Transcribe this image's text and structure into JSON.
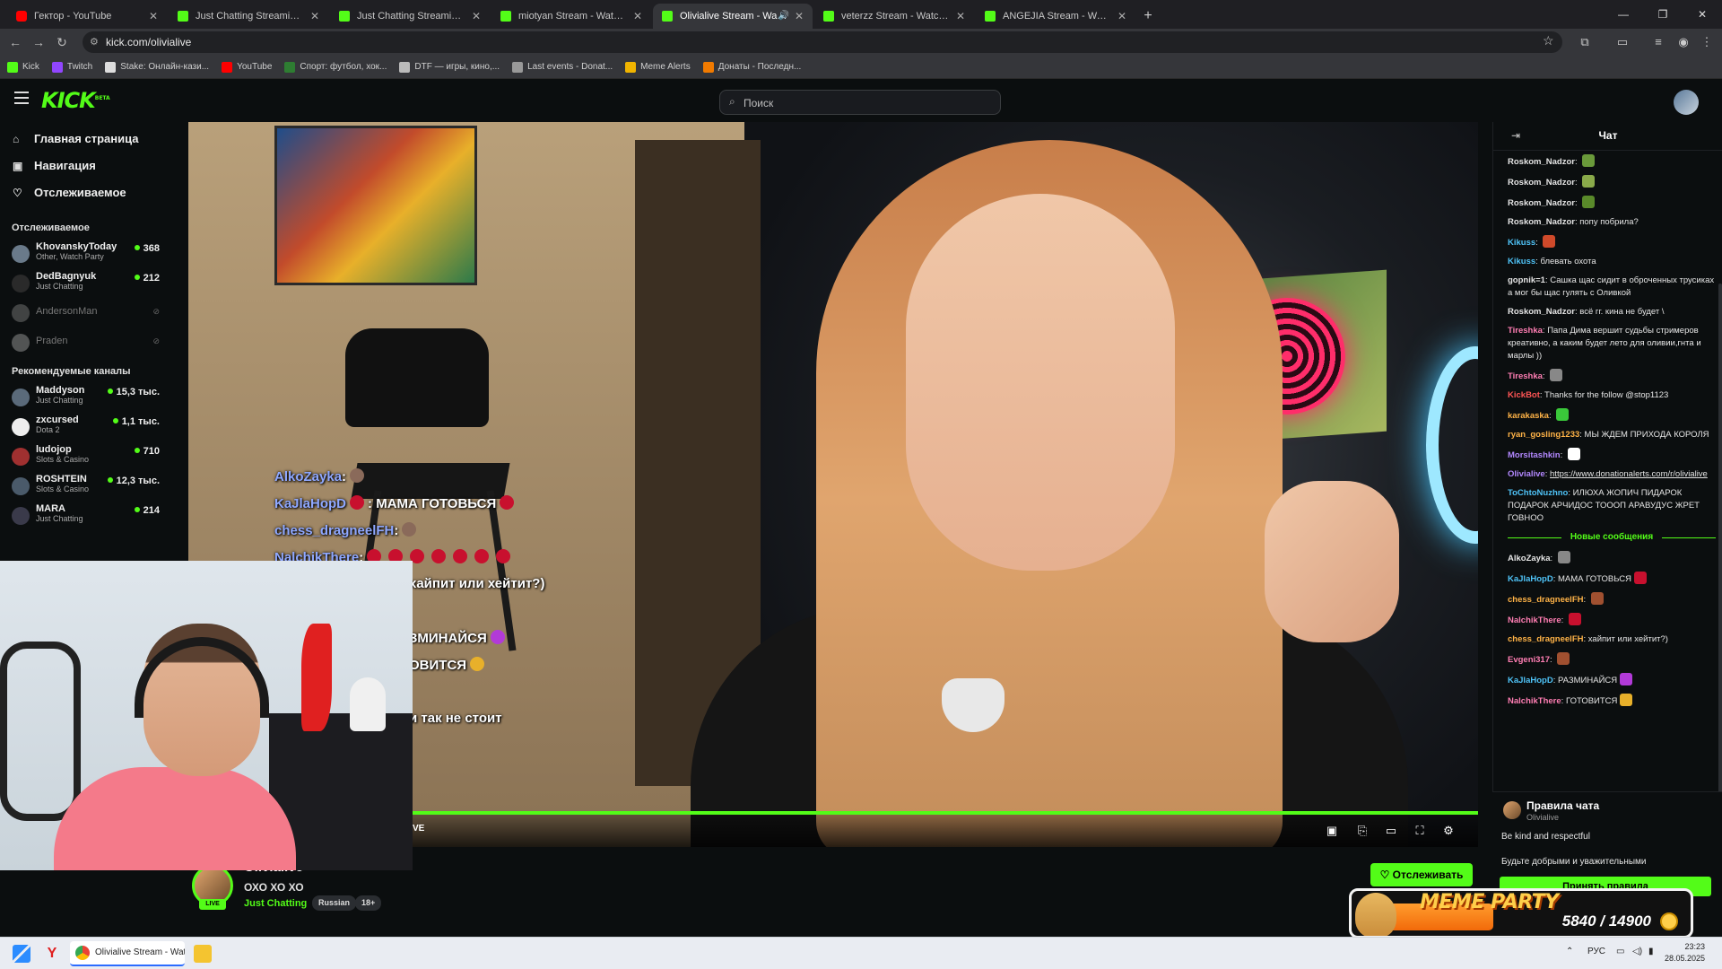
{
  "browser": {
    "tabs": [
      {
        "title": "Гектор - YouTube",
        "icon": "youtube-icon",
        "active": false
      },
      {
        "title": "Just Chatting Streaming - Live",
        "icon": "kick-icon",
        "active": false
      },
      {
        "title": "Just Chatting Streaming - Live",
        "icon": "kick-icon",
        "active": false
      },
      {
        "title": "miotyan Stream - Watch Live on",
        "icon": "kick-icon",
        "active": false
      },
      {
        "title": "Olivialive Stream - Watch Li",
        "icon": "kick-icon",
        "active": true
      },
      {
        "title": "veterzz Stream - Watch Live on",
        "icon": "kick-icon",
        "active": false
      },
      {
        "title": "ANGEJIA Stream - Watch Live o",
        "icon": "kick-icon",
        "active": false
      }
    ],
    "url": "kick.com/olivialive",
    "bookmarks": [
      {
        "label": "Kick",
        "color": "#53fc18"
      },
      {
        "label": "Twitch",
        "color": "#9146ff"
      },
      {
        "label": "Stake: Онлайн-кази...",
        "color": "#dddddd"
      },
      {
        "label": "YouTube",
        "color": "#ff0000"
      },
      {
        "label": "Спорт: футбол, хок...",
        "color": "#2e7d32"
      },
      {
        "label": "DTF — игры, кино,...",
        "color": "#bbbbbb"
      },
      {
        "label": "Last events - Donat...",
        "color": "#999999"
      },
      {
        "label": "Meme Alerts",
        "color": "#f0b400"
      },
      {
        "label": "Донаты - Последн...",
        "color": "#f07a00"
      }
    ]
  },
  "header": {
    "logo": "KICK",
    "logo_badge": "BETA",
    "search_placeholder": "Поиск"
  },
  "sidebar": {
    "nav": [
      {
        "label": "Главная страница",
        "icon": "home-icon",
        "glyph": "⌂"
      },
      {
        "label": "Навигация",
        "icon": "browse-icon",
        "glyph": "▣"
      },
      {
        "label": "Отслеживаемое",
        "icon": "heart-icon",
        "glyph": "♡"
      }
    ],
    "following_title": "Отслеживаемое",
    "following": [
      {
        "name": "KhovanskyToday",
        "category": "Other, Watch Party",
        "viewers": "368",
        "online": true,
        "color": "#6a7a8a"
      },
      {
        "name": "DedBagnyuk",
        "category": "Just Chatting",
        "viewers": "212",
        "online": true,
        "color": "#2a2a2a"
      },
      {
        "name": "AndersonMan",
        "category": "",
        "viewers": "",
        "online": false,
        "color": "#777777"
      },
      {
        "name": "Praden",
        "category": "",
        "viewers": "",
        "online": false,
        "color": "#999999"
      }
    ],
    "recommended_title": "Рекомендуемые каналы",
    "recommended": [
      {
        "name": "Maddyson",
        "category": "Just Chatting",
        "viewers": "15,3 тыс.",
        "color": "#5a6a7a"
      },
      {
        "name": "zxcursed",
        "category": "Dota 2",
        "viewers": "1,1 тыс.",
        "color": "#eeeeee"
      },
      {
        "name": "ludojop",
        "category": "Slots & Casino",
        "viewers": "710",
        "color": "#a03030"
      },
      {
        "name": "ROSHTEIN",
        "category": "Slots & Casino",
        "viewers": "12,3 тыс.",
        "color": "#4a5a6a"
      },
      {
        "name": "MARA",
        "category": "Just Chatting",
        "viewers": "214",
        "color": "#3a3a4a"
      }
    ]
  },
  "video": {
    "overlay_chat": [
      {
        "user": "AlkoZayka",
        "text": ":",
        "emotes": 1,
        "emote_color": "gray"
      },
      {
        "user": "KaJlaHopD",
        "text": ":  МАМА ГОТОВЬСЯ",
        "emotes": 2,
        "emote_color": "red"
      },
      {
        "user": "chess_dragneelFH",
        "text": ":",
        "emotes": 1,
        "emote_color": "gray"
      },
      {
        "user": "NalchikThere",
        "text": ":",
        "emotes": 7,
        "emote_color": "red"
      },
      {
        "user": "",
        "text": "хайпит или хейтит?)",
        "emotes": 0,
        "emote_color": ""
      },
      {
        "user": "",
        "text": "",
        "emotes": 0,
        "emote_color": ""
      },
      {
        "user": "",
        "text": "ЗМИНАЙСЯ",
        "emotes": 1,
        "emote_color": "purple"
      },
      {
        "user": "",
        "text": "ОВИТСЯ",
        "emotes": 1,
        "emote_color": "gold"
      },
      {
        "user": "",
        "text": "",
        "emotes": 0,
        "emote_color": ""
      },
      {
        "user": "",
        "text": "и так не стоит",
        "emotes": 0,
        "emote_color": ""
      }
    ],
    "live_fragment": "VE",
    "progress": 1.0
  },
  "streamer": {
    "name": "Olivialive",
    "title": "ОХО ХО ХО",
    "category": "Just Chatting",
    "tags": [
      "Russian",
      "18+"
    ],
    "live_badge": "LIVE",
    "follow_label": "Отслеживать"
  },
  "chat": {
    "title": "Чат",
    "messages": [
      {
        "user": "Roskom_Nadzor",
        "text": "",
        "color": "#e6e6e6",
        "emote": "#6a9a3a"
      },
      {
        "user": "Roskom_Nadzor",
        "text": "",
        "color": "#e6e6e6",
        "emote": "#8aaa4a"
      },
      {
        "user": "Roskom_Nadzor",
        "text": "",
        "color": "#e6e6e6",
        "emote": "#5a8a2a"
      },
      {
        "user": "Roskom_Nadzor",
        "text": "попу побрила?",
        "color": "#e6e6e6",
        "emote": ""
      },
      {
        "user": "Kikuss",
        "text": "",
        "color": "#4fc3f7",
        "emote": "#d04a2a"
      },
      {
        "user": "Kikuss",
        "text": "блевать охота",
        "color": "#4fc3f7",
        "emote": ""
      },
      {
        "user": "gopnik=1",
        "text": "Сашка щас сидит в оброченных трусиках а мог бы щас гулять с Оливкой",
        "color": "#e6e6e6",
        "emote": ""
      },
      {
        "user": "Roskom_Nadzor",
        "text": "всё гг. кина не будет \\",
        "color": "#e6e6e6",
        "emote": ""
      },
      {
        "user": "Tireshka",
        "text": "Папа Дима вершит судьбы стримеров креативно, а каким будет лето для оливии,гнта и марлы ))",
        "color": "#ff7eb3",
        "emote": ""
      },
      {
        "user": "Tireshka",
        "text": "",
        "color": "#ff7eb3",
        "emote": "#888888"
      },
      {
        "user": "KickBot",
        "text": "Thanks for the follow @stop1123",
        "color": "#ff5555",
        "emote": ""
      },
      {
        "user": "karakaska",
        "text": "",
        "color": "#ffb347",
        "emote": "#3ac83a"
      },
      {
        "user": "ryan_gosling1233",
        "text": "МЫ ЖДЕМ ПРИХОДА КОРОЛЯ",
        "color": "#ffb347",
        "emote": ""
      },
      {
        "user": "Morsitashkin",
        "text": "",
        "color": "#b388ff",
        "emote": "#ffffff"
      },
      {
        "user": "Olivialive",
        "text": "https://www.donationalerts.com/r/olivialive",
        "color": "#b388ff",
        "emote": ""
      },
      {
        "user": "ToChtoNuzhno",
        "text": "ИЛЮХА ЖОПИЧ ПИДАРОК ПОДАРОК АРЧИДОС ТОООП АРАВУДУС ЖРЕТ ГОВНОО",
        "color": "#4fc3f7",
        "emote": ""
      }
    ],
    "new_messages_label": "Новые сообщения",
    "new_messages": [
      {
        "user": "AlkoZayka",
        "text": "",
        "color": "#e6e6e6",
        "emote": "#888888"
      },
      {
        "user": "KaJlaHopD",
        "text": "МАМА ГОТОВЬСЯ",
        "color": "#4fc3f7",
        "emote": "#c8102e"
      },
      {
        "user": "chess_dragneelFH",
        "text": "",
        "color": "#ffb347",
        "emote": "#a05030"
      },
      {
        "user": "NalchikThere",
        "text": "",
        "color": "#ff7eb3",
        "emote": "#c8102e"
      },
      {
        "user": "chess_dragneelFH",
        "text": "хайпит или хейтит?)",
        "color": "#ffb347",
        "emote": ""
      },
      {
        "user": "Evgeni317",
        "text": "",
        "color": "#ff7eb3",
        "emote": "#a05030"
      },
      {
        "user": "KaJlaHopD",
        "text": "РАЗМИНАЙСЯ",
        "color": "#4fc3f7",
        "emote": "#b23ad8"
      },
      {
        "user": "NalchikThere",
        "text": "ГОТОВИТСЯ",
        "color": "#ff7eb3",
        "emote": "#e8b02a"
      }
    ],
    "rules_title": "Правила чата",
    "rules_author": "Olivialive",
    "rule_1": "Be kind and respectful",
    "rule_2": "Будьте добрыми и уважительными",
    "accept_label": "Принять правила"
  },
  "meme_party": {
    "title": "MEME PARTY",
    "value": "5840 / 14900",
    "progress": 0.392
  },
  "taskbar": {
    "chrome_label": "Olivialive Stream - Watc",
    "lang": "РУС",
    "time": "23:23",
    "date": "28.05.2025"
  }
}
